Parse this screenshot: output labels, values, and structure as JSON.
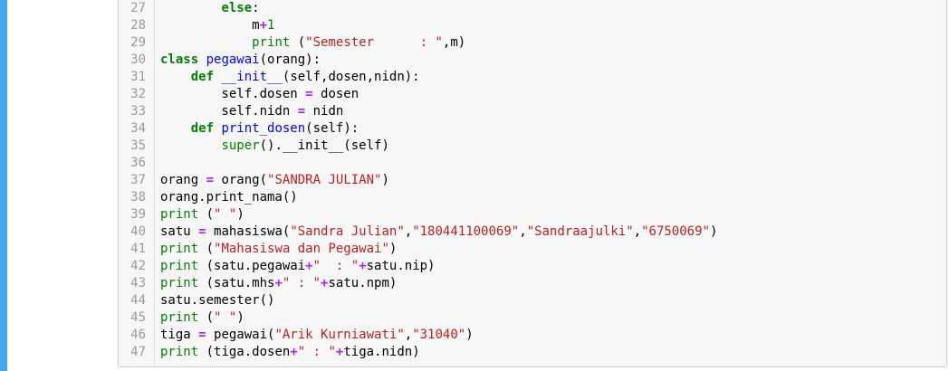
{
  "editor": {
    "lines": [
      {
        "n": "27",
        "tokens": [
          {
            "t": "        "
          },
          {
            "t": "else",
            "k": "kw"
          },
          {
            "t": ":"
          }
        ]
      },
      {
        "n": "28",
        "tokens": [
          {
            "t": "            m"
          },
          {
            "t": "+",
            "k": "op"
          },
          {
            "t": "1",
            "k": "num"
          }
        ]
      },
      {
        "n": "29",
        "tokens": [
          {
            "t": "            "
          },
          {
            "t": "print",
            "k": "bi"
          },
          {
            "t": " ("
          },
          {
            "t": "\"Semester      : \"",
            "k": "str"
          },
          {
            "t": ",m)"
          }
        ]
      },
      {
        "n": "30",
        "tokens": [
          {
            "t": "class",
            "k": "kw"
          },
          {
            "t": " "
          },
          {
            "t": "pegawai",
            "k": "def"
          },
          {
            "t": "(orang):"
          }
        ]
      },
      {
        "n": "31",
        "tokens": [
          {
            "t": "    "
          },
          {
            "t": "def",
            "k": "kw"
          },
          {
            "t": " "
          },
          {
            "t": "__init__",
            "k": "def"
          },
          {
            "t": "(self,dosen,nidn):"
          }
        ]
      },
      {
        "n": "32",
        "tokens": [
          {
            "t": "        self.dosen "
          },
          {
            "t": "=",
            "k": "op"
          },
          {
            "t": " dosen"
          }
        ]
      },
      {
        "n": "33",
        "tokens": [
          {
            "t": "        self.nidn "
          },
          {
            "t": "=",
            "k": "op"
          },
          {
            "t": " nidn"
          }
        ]
      },
      {
        "n": "34",
        "tokens": [
          {
            "t": "    "
          },
          {
            "t": "def",
            "k": "kw"
          },
          {
            "t": " "
          },
          {
            "t": "print_dosen",
            "k": "def"
          },
          {
            "t": "(self):"
          }
        ]
      },
      {
        "n": "35",
        "tokens": [
          {
            "t": "        "
          },
          {
            "t": "super",
            "k": "bi"
          },
          {
            "t": "().__init__(self)"
          }
        ]
      },
      {
        "n": "36",
        "tokens": []
      },
      {
        "n": "37",
        "tokens": [
          {
            "t": "orang "
          },
          {
            "t": "=",
            "k": "op"
          },
          {
            "t": " orang("
          },
          {
            "t": "\"SANDRA JULIAN\"",
            "k": "str"
          },
          {
            "t": ")"
          }
        ]
      },
      {
        "n": "38",
        "tokens": [
          {
            "t": "orang.print_nama()"
          }
        ]
      },
      {
        "n": "39",
        "tokens": [
          {
            "t": "print",
            "k": "bi"
          },
          {
            "t": " ("
          },
          {
            "t": "\" \"",
            "k": "str"
          },
          {
            "t": ")"
          }
        ]
      },
      {
        "n": "40",
        "tokens": [
          {
            "t": "satu "
          },
          {
            "t": "=",
            "k": "op"
          },
          {
            "t": " mahasiswa("
          },
          {
            "t": "\"Sandra Julian\"",
            "k": "str"
          },
          {
            "t": ","
          },
          {
            "t": "\"180441100069\"",
            "k": "str"
          },
          {
            "t": ","
          },
          {
            "t": "\"Sandraajulki\"",
            "k": "str"
          },
          {
            "t": ","
          },
          {
            "t": "\"6750069\"",
            "k": "str"
          },
          {
            "t": ")"
          }
        ]
      },
      {
        "n": "41",
        "tokens": [
          {
            "t": "print",
            "k": "bi"
          },
          {
            "t": " ("
          },
          {
            "t": "\"Mahasiswa dan Pegawai\"",
            "k": "str"
          },
          {
            "t": ")"
          }
        ]
      },
      {
        "n": "42",
        "tokens": [
          {
            "t": "print",
            "k": "bi"
          },
          {
            "t": " (satu.pegawai"
          },
          {
            "t": "+",
            "k": "op"
          },
          {
            "t": "\"  : \"",
            "k": "str"
          },
          {
            "t": "+",
            "k": "op"
          },
          {
            "t": "satu.nip)"
          }
        ]
      },
      {
        "n": "43",
        "tokens": [
          {
            "t": "print",
            "k": "bi"
          },
          {
            "t": " (satu.mhs"
          },
          {
            "t": "+",
            "k": "op"
          },
          {
            "t": "\" : \"",
            "k": "str"
          },
          {
            "t": "+",
            "k": "op"
          },
          {
            "t": "satu.npm)"
          }
        ]
      },
      {
        "n": "44",
        "tokens": [
          {
            "t": "satu.semester()"
          }
        ]
      },
      {
        "n": "45",
        "tokens": [
          {
            "t": "print",
            "k": "bi"
          },
          {
            "t": " ("
          },
          {
            "t": "\" \"",
            "k": "str"
          },
          {
            "t": ")"
          }
        ]
      },
      {
        "n": "46",
        "tokens": [
          {
            "t": "tiga "
          },
          {
            "t": "=",
            "k": "op"
          },
          {
            "t": " pegawai("
          },
          {
            "t": "\"Arik Kurniawati\"",
            "k": "str"
          },
          {
            "t": ","
          },
          {
            "t": "\"31040\"",
            "k": "str"
          },
          {
            "t": ")"
          }
        ]
      },
      {
        "n": "47",
        "tokens": [
          {
            "t": "print",
            "k": "bi"
          },
          {
            "t": " (tiga.dosen"
          },
          {
            "t": "+",
            "k": "op"
          },
          {
            "t": "\" : \"",
            "k": "str"
          },
          {
            "t": "+",
            "k": "op"
          },
          {
            "t": "tiga.nidn)"
          }
        ]
      }
    ]
  },
  "colors": {
    "selection_bar": "#42a5f5",
    "keyword": "#008000",
    "string": "#ba2121",
    "operator": "#aa22ff",
    "definition": "#0000ff",
    "line_number": "#999999"
  }
}
